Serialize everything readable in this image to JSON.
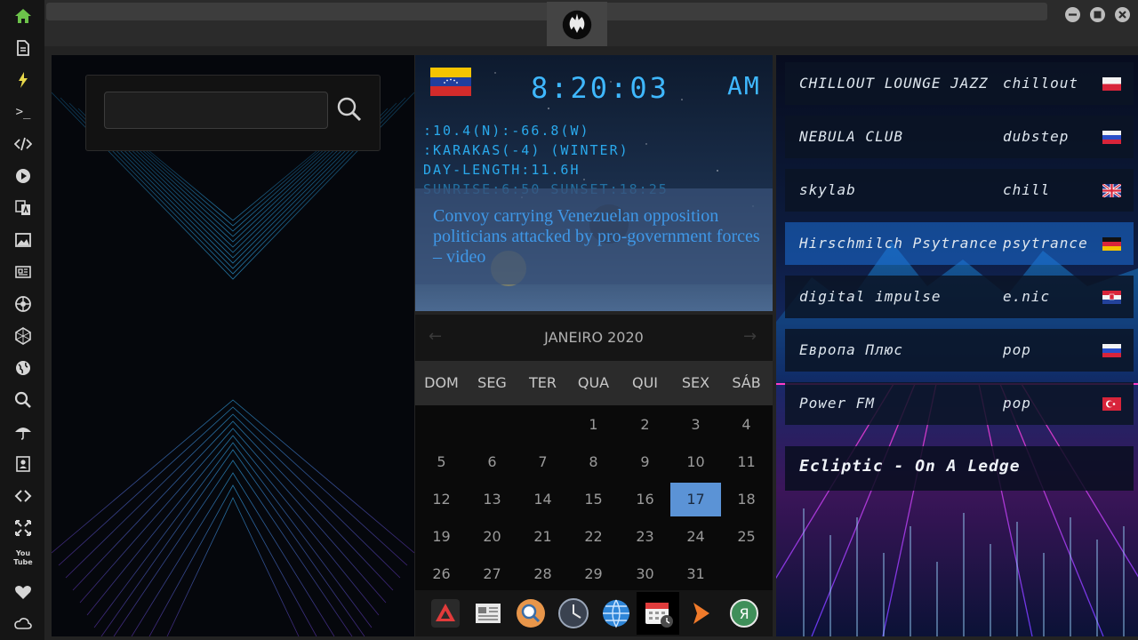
{
  "sidebar": {
    "icons": [
      "home-icon",
      "document-icon",
      "lightning-icon",
      "terminal-icon",
      "code-icon",
      "play-icon",
      "translate-icon",
      "image-icon",
      "news-icon",
      "aperture-icon",
      "hexagon-icon",
      "globe-icon",
      "search-icon",
      "umbrella-icon",
      "contacts-icon",
      "link-icon",
      "move-icon",
      "youtube-icon",
      "heart-icon",
      "cloud-icon"
    ],
    "terminal_glyph": ">_",
    "youtube_text": "You Tube"
  },
  "clock": {
    "time": "8:20:03",
    "ampm": "AM",
    "coords": ":10.4(N):-66.8(W)",
    "city": ":KARAKAS(-4) (WINTER)",
    "day_length": "DAY-LENGTH:11.6H",
    "sun": "SUNRISE:6:50 SUNSET:18:25"
  },
  "news": {
    "headline": "Convoy carrying Venezuelan opposition politicians attacked by pro-government forces – video"
  },
  "calendar": {
    "month_label": "JANEIRO 2020",
    "prev": "←",
    "next": "→",
    "weekdays": [
      "DOM",
      "SEG",
      "TER",
      "QUA",
      "QUI",
      "SEX",
      "SÁB"
    ],
    "weeks": [
      [
        "",
        "",
        "",
        "1",
        "2",
        "3",
        "4"
      ],
      [
        "5",
        "6",
        "7",
        "8",
        "9",
        "10",
        "11"
      ],
      [
        "12",
        "13",
        "14",
        "15",
        "16",
        "17",
        "18"
      ],
      [
        "19",
        "20",
        "21",
        "22",
        "23",
        "24",
        "25"
      ],
      [
        "26",
        "27",
        "28",
        "29",
        "30",
        "31",
        ""
      ]
    ],
    "today": "17"
  },
  "dock": {
    "icons": [
      "anydesk-icon",
      "news-reader-icon",
      "search-app-icon",
      "clock-app-icon",
      "browser-globe-icon",
      "calendar-app-icon",
      "arrow-app-icon",
      "yandex-icon"
    ]
  },
  "radio": {
    "stations": [
      {
        "name": "CHILLOUT LOUNGE JAZZ",
        "genre": "chillout",
        "flag": "poland"
      },
      {
        "name": "NEBULA CLUB",
        "genre": "dubstep",
        "flag": "russia"
      },
      {
        "name": "skylab",
        "genre": "chill",
        "flag": "uk"
      },
      {
        "name": "Hirschmilch Psytrance",
        "genre": "psytrance",
        "flag": "germany"
      },
      {
        "name": "digital impulse",
        "genre": "e.nic",
        "flag": "croatia"
      },
      {
        "name": "Европа Плюс",
        "genre": "pop",
        "flag": "russia"
      },
      {
        "name": "Power FM",
        "genre": "pop",
        "flag": "turkey"
      }
    ],
    "now_playing": "Ecliptic - On A Ledge"
  },
  "colors": {
    "accent_blue": "#3fb8ff",
    "calendar_today": "#5b93d6",
    "active_station": "#1c6fd8"
  }
}
